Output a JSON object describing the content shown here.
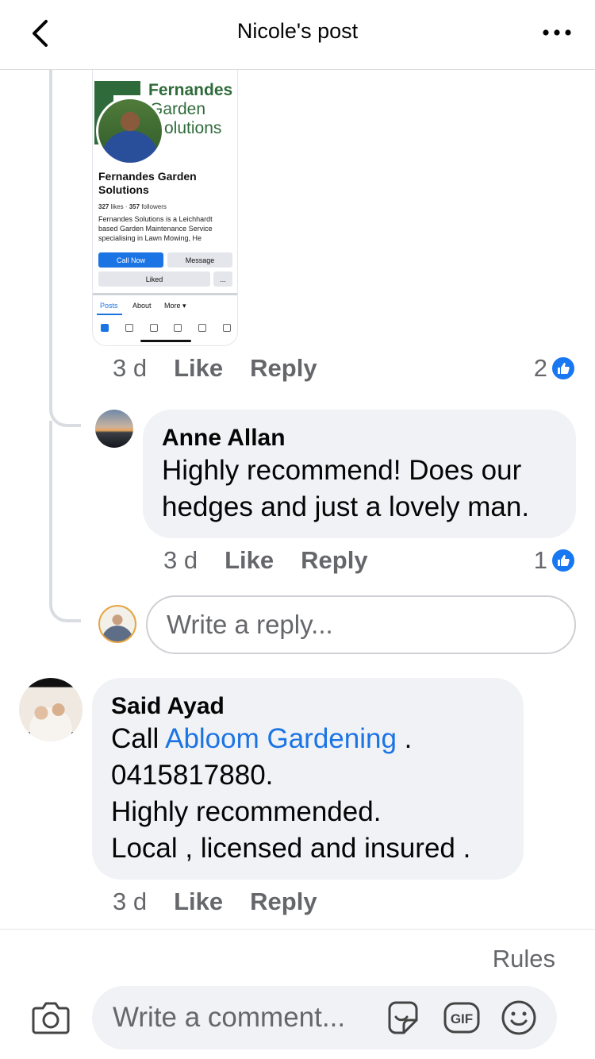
{
  "header": {
    "title": "Nicole's post"
  },
  "shared_image": {
    "brand_line1": "Fernandes",
    "brand_line2": "Garden",
    "brand_line3": "Solutions",
    "page_name": "Fernandes Garden Solutions",
    "likes": "327",
    "likes_label": "likes",
    "followers": "357",
    "followers_label": "followers",
    "description": "Fernandes Solutions is a Leichhardt based Garden Maintenance Service specialising in Lawn Mowing, He",
    "call_button": "Call Now",
    "message_button": "Message",
    "liked_button": "Liked",
    "more_button": "...",
    "tabs": [
      "Posts",
      "About",
      "More ▾"
    ]
  },
  "comment_nicole": {
    "time": "3 d",
    "like_label": "Like",
    "reply_label": "Reply",
    "reaction_count": "2"
  },
  "comment_anne": {
    "author": "Anne Allan",
    "text": "Highly recommend! Does our hedges and just a lovely man.",
    "time": "3 d",
    "like_label": "Like",
    "reply_label": "Reply",
    "reaction_count": "1"
  },
  "reply_box": {
    "placeholder": "Write a reply..."
  },
  "comment_said": {
    "author": "Said Ayad",
    "line1_prefix": "Call ",
    "line1_link": "Abloom Gardening",
    "line1_suffix": " .",
    "line2": "0415817880.",
    "line3": "Highly recommended.",
    "line4": "Local  , licensed and insured .",
    "time": "3 d",
    "like_label": "Like",
    "reply_label": "Reply"
  },
  "composer": {
    "rules_label": "Rules",
    "placeholder": "Write a comment..."
  },
  "colors": {
    "accent": "#1877f2",
    "bubble": "#f0f2f5",
    "muted_text": "#65676b"
  }
}
